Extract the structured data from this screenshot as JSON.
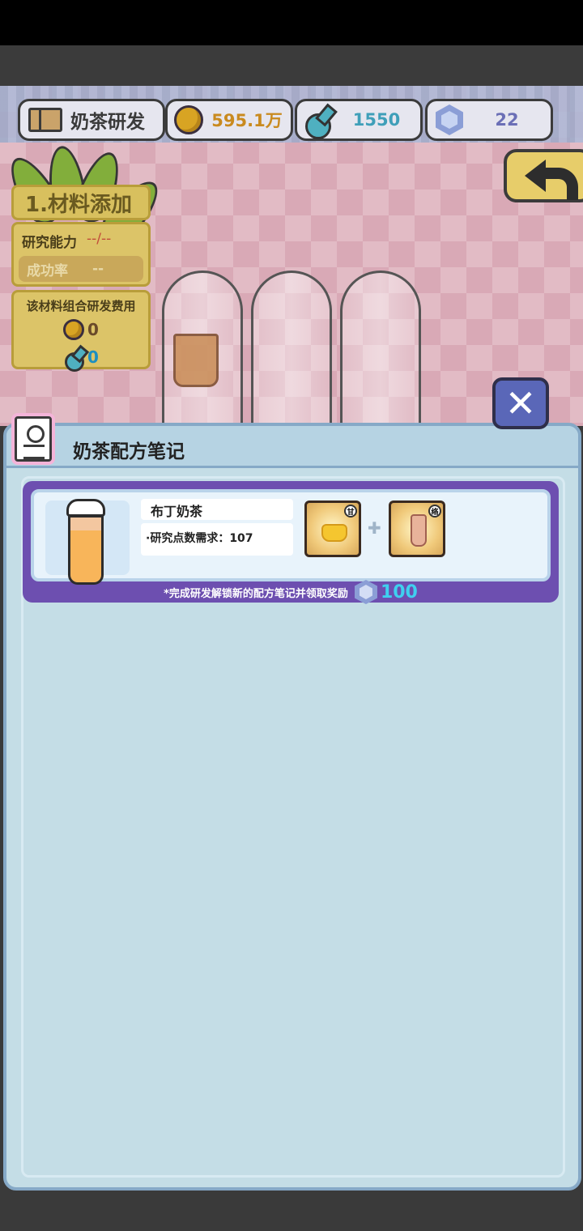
{
  "hud": {
    "title": "奶茶研发",
    "coins": "595.1万",
    "flasks": "1550",
    "gems": "22"
  },
  "colors": {
    "coin_text": "#c98a1f",
    "flask_text": "#3f9fb9",
    "gem_text": "#6b6fb6",
    "cost_flask": "#1c8fc1"
  },
  "research": {
    "step_label": "1.材料添加",
    "ability_label": "研究能力",
    "ability_value": "--/--",
    "success_label": "成功率",
    "success_value": "--",
    "cost_title": "该材料组合研发费用",
    "cost_coins": "0",
    "cost_flasks": "0"
  },
  "panel": {
    "title": "奶茶配方笔记",
    "recipe": {
      "name": "布丁奶茶",
      "requirement": "·研究点数需求：107",
      "ingredient1_badge": "甘",
      "ingredient2_badge": "络",
      "reward_text": "*完成研发解锁新的配方笔记并领取奖励",
      "reward_amount": "100"
    }
  }
}
